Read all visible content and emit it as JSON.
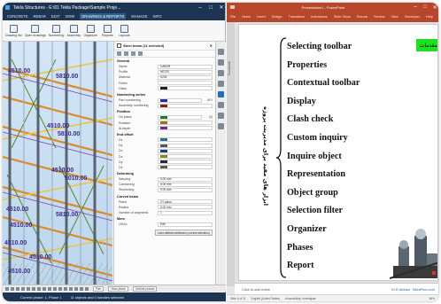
{
  "tekla": {
    "title": "Tekla Structures - E:\\01 Tekla Package\\Sample Proje...",
    "window_controls": [
      "–",
      "□",
      "✕"
    ],
    "menu": [
      "CONCRETE",
      "REBAR",
      "EDIT",
      "VIEW",
      "DRAWINGS & REPORTS",
      "MANAGE",
      "INFO"
    ],
    "menu_active_index": 4,
    "ribbon": [
      {
        "icon": "drawing-list-icon",
        "label": "Drawing list"
      },
      {
        "icon": "open-drawings-icon",
        "label": "Open drawings"
      },
      {
        "icon": "numbering-icon",
        "label": "Numbering"
      },
      {
        "icon": "assembly-icon",
        "label": "Assembly"
      },
      {
        "icon": "organizer-icon",
        "label": "Organizer"
      },
      {
        "icon": "reports-icon",
        "label": "Reports"
      },
      {
        "icon": "layouts-icon",
        "label": "Layouts"
      }
    ],
    "properties": {
      "header": "Steel beam (11 selected)",
      "close": "✕",
      "sections": [
        {
          "title": "General",
          "rows": [
            {
              "label": "Name",
              "value": "CABOR"
            },
            {
              "label": "Profile",
              "value": "HE220"
            },
            {
              "label": "Material",
              "value": "S235"
            },
            {
              "label": "Finish",
              "value": ""
            },
            {
              "label": "Class",
              "value": "",
              "color": "#222222"
            }
          ]
        },
        {
          "title": "Numbering series",
          "rows": [
            {
              "label": "Part numbering",
              "value": "",
              "color": "#2a2f8f",
              "extra": "AP1"
            },
            {
              "label": "Assembly numbering",
              "value": "",
              "color": "#8a1b1b"
            }
          ]
        },
        {
          "title": "Position",
          "rows": [
            {
              "label": "On plane",
              "value": "",
              "color": "#1e7b36",
              "extra": "[0]"
            },
            {
              "label": "Rotation",
              "value": "",
              "color": "#a86d12"
            },
            {
              "label": "At depth",
              "value": "",
              "color": "#6c2a8a"
            }
          ]
        },
        {
          "title": "End offset",
          "rows": [
            {
              "label": "Dx",
              "value": "",
              "color": "#2a6b8a"
            },
            {
              "label": "Dy",
              "value": "",
              "color": "#555555"
            },
            {
              "label": "Dz",
              "value": "",
              "color": "#1b3d8a"
            },
            {
              "label": "Dx",
              "value": "",
              "color": "#8a8a1b"
            },
            {
              "label": "Dy",
              "value": "",
              "color": "#2a2a2a"
            },
            {
              "label": "Dz",
              "value": "",
              "color": "#5c5c5c"
            }
          ]
        },
        {
          "title": "Deforming",
          "rows": [
            {
              "label": "Warping",
              "value": "0.00 mm"
            },
            {
              "label": "Cambering",
              "value": "0.00 mm"
            },
            {
              "label": "Shortening",
              "value": "0.00 mm"
            }
          ]
        },
        {
          "title": "Curved beam",
          "rows": [
            {
              "label": "Plane",
              "value": "XY plane"
            },
            {
              "label": "Radius",
              "value": "0.00 mm"
            },
            {
              "label": "Number of segments",
              "value": "1"
            }
          ]
        },
        {
          "title": "More",
          "rows": [
            {
              "label": "UDAs",
              "value": "Edit"
            }
          ]
        }
      ],
      "button": "User-defined attributes (current selection)"
    },
    "labels_3d": [
      "4510.00",
      "5810.00",
      "4510.00",
      "5810.00",
      "4510.00",
      "5010.00",
      "4510.00",
      "5810.00",
      "4510.00",
      "4510.00",
      "4510.00",
      "4510.00"
    ],
    "bottombar": {
      "select_1": "Part",
      "select_2": "View plane",
      "select_3": "Outline planes"
    },
    "status": [
      "Current phase: 1, Phase 1",
      "11 objects and 0 handles selected"
    ]
  },
  "ppt": {
    "title": "Presentation1 - PowerPoint",
    "window_controls": [
      "–",
      "□",
      "✕"
    ],
    "tabs": [
      "File",
      "Home",
      "Insert",
      "Design",
      "Transitions",
      "Animations",
      "Slide Show",
      "Record",
      "Review",
      "View",
      "Developer",
      "Help"
    ],
    "thumb_label": "Thumbnails",
    "green_tag": "مقدمات)",
    "vertical_text": "ابزار های مفید برای مدیریت پروژه",
    "items": [
      "Selecting toolbar",
      "Properties",
      "Contextual toolbar",
      "Display",
      "Clash check",
      "Custom inquiry",
      "Inquire object",
      "Representation",
      "Object group",
      "Selection filter",
      "Organizer",
      "Phases",
      "Report"
    ],
    "notes_placeholder": "Click to add notes",
    "watermark_name": "M.R.Abbasi",
    "watermark_site": "TeklaPlus.com",
    "status": [
      "Slide 6 of 11",
      "English (United States)",
      "Accessibility: Investigate"
    ],
    "zoom": "66%"
  }
}
